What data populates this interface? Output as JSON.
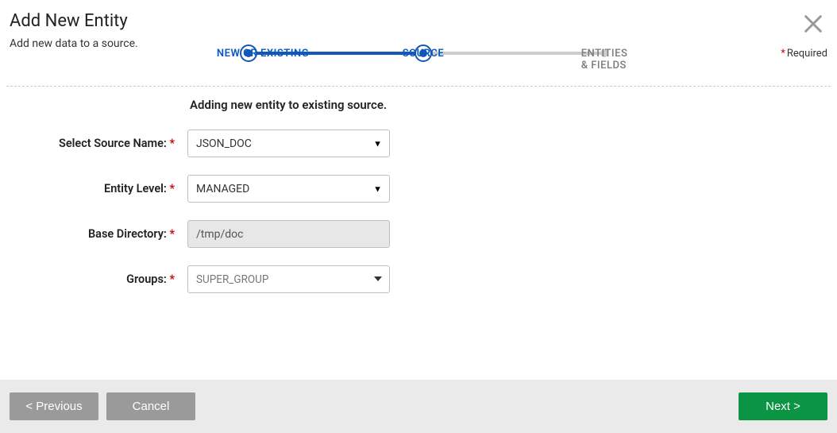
{
  "header": {
    "title": "Add New Entity",
    "subtitle": "Add new data to a source.",
    "required_label": "Required"
  },
  "stepper": {
    "steps": [
      {
        "label": "NEW OR EXISTING",
        "state": "done"
      },
      {
        "label": "SOURCE",
        "state": "done"
      },
      {
        "label": "ENTITIES & FIELDS",
        "state": "future"
      }
    ]
  },
  "form": {
    "heading": "Adding new entity to existing source.",
    "fields": {
      "source_name": {
        "label": "Select Source Name:",
        "value": "JSON_DOC",
        "required": true
      },
      "entity_level": {
        "label": "Entity Level:",
        "value": "MANAGED",
        "required": true
      },
      "base_directory": {
        "label": "Base Directory:",
        "value": "/tmp/doc",
        "required": true
      },
      "groups": {
        "label": "Groups:",
        "value": "SUPER_GROUP",
        "required": true
      }
    }
  },
  "footer": {
    "previous": "< Previous",
    "cancel": "Cancel",
    "next": "Next >"
  }
}
